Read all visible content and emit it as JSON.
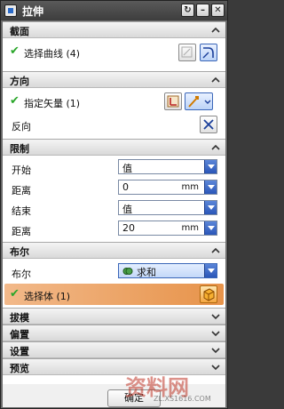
{
  "window": {
    "title": "拉伸",
    "buttons": [
      "restore-icon",
      "minimize-icon",
      "close-icon"
    ]
  },
  "sections": {
    "section": {
      "title": "截面",
      "select_curve": "选择曲线 (4)"
    },
    "direction": {
      "title": "方向",
      "specify_vector": "指定矢量 (1)",
      "reverse": "反向"
    },
    "limits": {
      "title": "限制",
      "start_label": "开始",
      "start_value": "值",
      "start_distance_label": "距离",
      "start_distance_value": "0",
      "start_unit": "mm",
      "end_label": "结束",
      "end_value": "值",
      "end_distance_label": "距离",
      "end_distance_value": "20",
      "end_unit": "mm"
    },
    "boolean": {
      "title": "布尔",
      "boolean_label": "布尔",
      "boolean_value": "求和",
      "select_body": "选择体 (1)"
    },
    "draft": {
      "title": "拔模"
    },
    "offset": {
      "title": "偏置"
    },
    "settings": {
      "title": "设置"
    },
    "preview": {
      "title": "预览"
    }
  },
  "footer": {
    "ok_label": "确定"
  },
  "watermark": {
    "brand": "资料网",
    "url": "ZL.XS1616.COM"
  },
  "colors": {
    "check": "#2aa62a",
    "select_body_bar": "#e7934a",
    "dropdown": "#2a56b8"
  }
}
